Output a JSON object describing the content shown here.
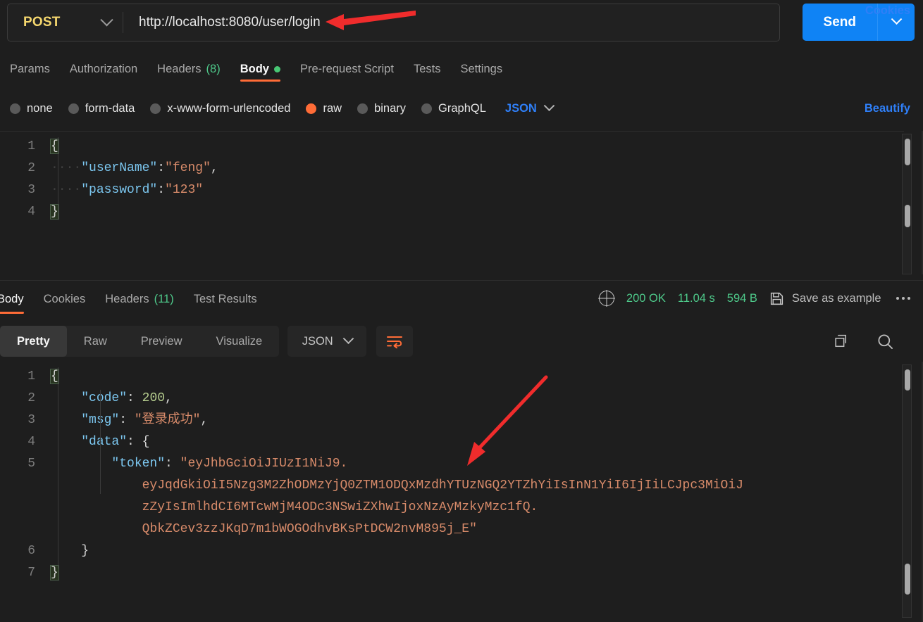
{
  "request": {
    "method": "POST",
    "url": "http://localhost:8080/user/login",
    "send_label": "Send",
    "tabs": [
      {
        "label": "Params",
        "count": "",
        "active": false,
        "dot": false
      },
      {
        "label": "Authorization",
        "count": "",
        "active": false,
        "dot": false
      },
      {
        "label": "Headers",
        "count": "(8)",
        "active": false,
        "dot": false
      },
      {
        "label": "Body",
        "count": "",
        "active": true,
        "dot": true
      },
      {
        "label": "Pre-request Script",
        "count": "",
        "active": false,
        "dot": false
      },
      {
        "label": "Tests",
        "count": "",
        "active": false,
        "dot": false
      },
      {
        "label": "Settings",
        "count": "",
        "active": false,
        "dot": false
      }
    ],
    "cookies_link": "Cookies",
    "body_types": [
      {
        "label": "none",
        "selected": false
      },
      {
        "label": "form-data",
        "selected": false
      },
      {
        "label": "x-www-form-urlencoded",
        "selected": false
      },
      {
        "label": "raw",
        "selected": true
      },
      {
        "label": "binary",
        "selected": false
      },
      {
        "label": "GraphQL",
        "selected": false
      }
    ],
    "format_selected": "JSON",
    "beautify_label": "Beautify",
    "body_lines": [
      {
        "num": "1",
        "tokens": [
          {
            "t": "{",
            "c": "brbox"
          }
        ]
      },
      {
        "num": "2",
        "tokens": [
          {
            "t": "····",
            "c": "dots"
          },
          {
            "t": "\"userName\"",
            "c": "k"
          },
          {
            "t": ":",
            "c": "p"
          },
          {
            "t": "\"feng\"",
            "c": "s"
          },
          {
            "t": ",",
            "c": "p"
          }
        ]
      },
      {
        "num": "3",
        "tokens": [
          {
            "t": "····",
            "c": "dots"
          },
          {
            "t": "\"password\"",
            "c": "k"
          },
          {
            "t": ":",
            "c": "p"
          },
          {
            "t": "\"123\"",
            "c": "s"
          }
        ]
      },
      {
        "num": "4",
        "tokens": [
          {
            "t": "}",
            "c": "brbox"
          }
        ]
      }
    ]
  },
  "response": {
    "tabs": [
      {
        "label": "Body",
        "count": "",
        "active": true
      },
      {
        "label": "Cookies",
        "count": "",
        "active": false
      },
      {
        "label": "Headers",
        "count": "(11)",
        "active": false
      },
      {
        "label": "Test Results",
        "count": "",
        "active": false
      }
    ],
    "status_code": "200 OK",
    "time": "11.04 s",
    "size": "594 B",
    "save_example_label": "Save as example",
    "view_tabs": [
      {
        "label": "Pretty",
        "active": true
      },
      {
        "label": "Raw",
        "active": false
      },
      {
        "label": "Preview",
        "active": false
      },
      {
        "label": "Visualize",
        "active": false
      }
    ],
    "format_selected": "JSON",
    "body_lines": [
      {
        "num": "1",
        "tokens": [
          {
            "t": "{",
            "c": "brbox"
          }
        ]
      },
      {
        "num": "2",
        "tokens": [
          {
            "t": "    ",
            "c": "p"
          },
          {
            "t": "\"code\"",
            "c": "k"
          },
          {
            "t": ": ",
            "c": "p"
          },
          {
            "t": "200",
            "c": "n"
          },
          {
            "t": ",",
            "c": "p"
          }
        ]
      },
      {
        "num": "3",
        "tokens": [
          {
            "t": "    ",
            "c": "p"
          },
          {
            "t": "\"msg\"",
            "c": "k"
          },
          {
            "t": ": ",
            "c": "p"
          },
          {
            "t": "\"登录成功\"",
            "c": "s"
          },
          {
            "t": ",",
            "c": "p"
          }
        ]
      },
      {
        "num": "4",
        "tokens": [
          {
            "t": "    ",
            "c": "p"
          },
          {
            "t": "\"data\"",
            "c": "k"
          },
          {
            "t": ": ",
            "c": "p"
          },
          {
            "t": "{",
            "c": "br"
          }
        ]
      },
      {
        "num": "5",
        "tokens": [
          {
            "t": "        ",
            "c": "p"
          },
          {
            "t": "\"token\"",
            "c": "k"
          },
          {
            "t": ": ",
            "c": "p"
          },
          {
            "t": "\"eyJhbGciOiJIUzI1NiJ9.",
            "c": "s"
          }
        ]
      },
      {
        "num": "",
        "tokens": [
          {
            "t": "            ",
            "c": "p"
          },
          {
            "t": "eyJqdGkiOiI5Nzg3M2ZhODMzYjQ0ZTM1ODQxMzdhYTUzNGQ2YTZhYiIsInN1YiI6IjIiLCJpc3MiOiJ",
            "c": "s"
          }
        ]
      },
      {
        "num": "",
        "tokens": [
          {
            "t": "            ",
            "c": "p"
          },
          {
            "t": "zZyIsImlhdCI6MTcwMjM4ODc3NSwiZXhwIjoxNzAyMzkyMzc1fQ.",
            "c": "s"
          }
        ]
      },
      {
        "num": "",
        "tokens": [
          {
            "t": "            ",
            "c": "p"
          },
          {
            "t": "QbkZCev3zzJKqD7m1bWOGOdhvBKsPtDCW2nvM895j_E\"",
            "c": "s"
          }
        ]
      },
      {
        "num": "6",
        "tokens": [
          {
            "t": "    ",
            "c": "p"
          },
          {
            "t": "}",
            "c": "br"
          }
        ]
      },
      {
        "num": "7",
        "tokens": [
          {
            "t": "}",
            "c": "brbox"
          }
        ]
      }
    ]
  },
  "icons": {
    "globe": "globe-icon",
    "save": "floppy-disk-icon",
    "copy": "copy-icon",
    "search": "search-icon",
    "wrap": "wrap-text-icon",
    "more": "more-options-icon"
  },
  "colors": {
    "accent": "#ff6c37",
    "link": "#2f7ff7",
    "success": "#4ec98a",
    "send": "#0f83f5",
    "method": "#f5d76e",
    "annotation": "#f02c2c"
  }
}
